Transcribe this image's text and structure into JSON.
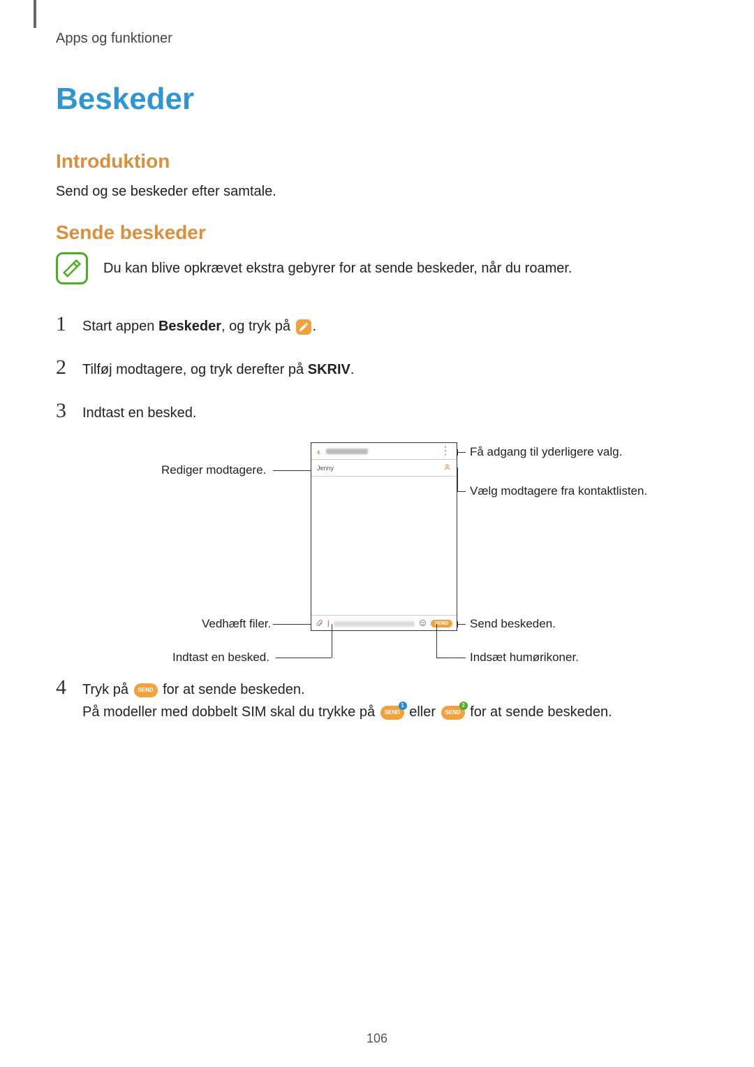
{
  "chapter": "Apps og funktioner",
  "title": "Beskeder",
  "intro_heading": "Introduktion",
  "intro_text": "Send og se beskeder efter samtale.",
  "send_heading": "Sende beskeder",
  "note": "Du kan blive opkrævet ekstra gebyrer for at sende beskeder, når du roamer.",
  "steps": {
    "1": {
      "pre": "Start appen ",
      "bold": "Beskeder",
      "post": ", og tryk på ",
      "tail": "."
    },
    "2": {
      "pre": "Tilføj modtagere, og tryk derefter på ",
      "bold": "SKRIV",
      "post": "."
    },
    "3": {
      "text": "Indtast en besked."
    },
    "4a": {
      "pre": "Tryk på ",
      "post": " for at sende beskeden."
    },
    "4b": {
      "pre": "På modeller med dobbelt SIM skal du trykke på ",
      "mid": " eller ",
      "post": " for at sende beskeden."
    }
  },
  "callouts": {
    "left_recipients": "Rediger modtagere.",
    "left_attach": "Vedhæft filer.",
    "left_enter": "Indtast en besked.",
    "right_more": "Få adgang til yderligere valg.",
    "right_contacts": "Vælg modtagere fra kontaktlisten.",
    "right_send": "Send beskeden.",
    "right_emoji": "Indsæt humørikoner."
  },
  "phone": {
    "recipient": "Jenny",
    "send_label": "SEND"
  },
  "page_number": "106"
}
